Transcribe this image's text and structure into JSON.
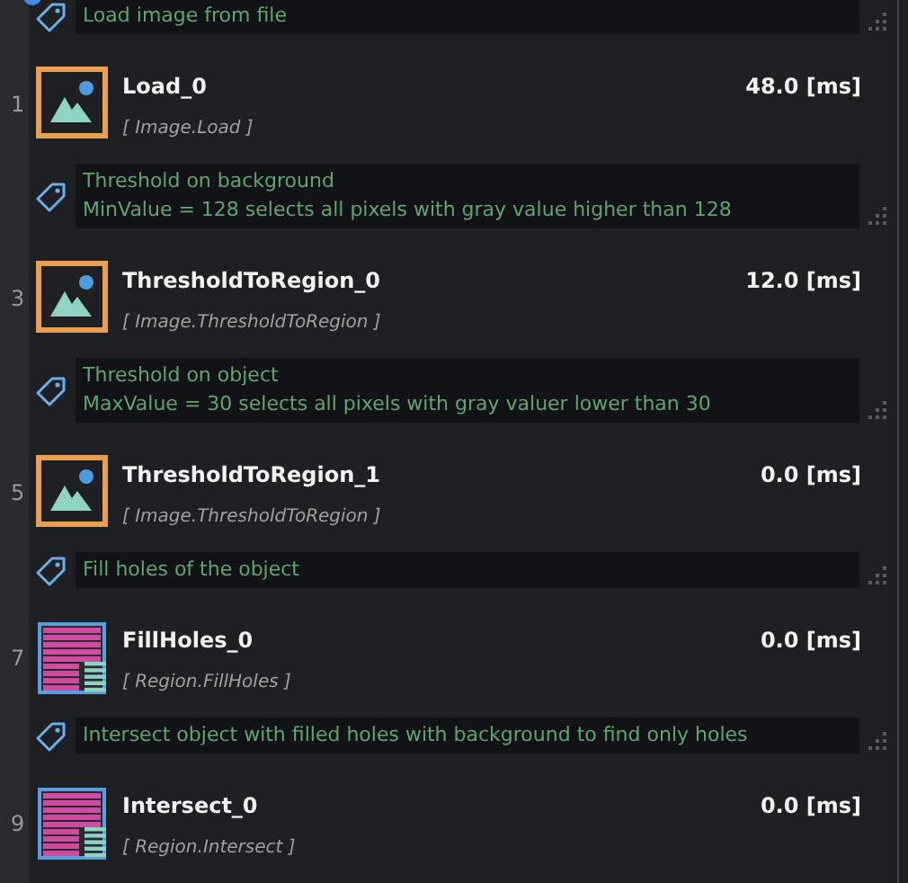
{
  "items": [
    {
      "kind": "comment",
      "lines": [
        "Load image from file"
      ]
    },
    {
      "kind": "image-step",
      "number": "1",
      "name": "Load_0",
      "type": "[ Image.Load ]",
      "time": "48.0 [ms]"
    },
    {
      "kind": "comment",
      "lines": [
        "Threshold on background",
        "MinValue = 128 selects all pixels with gray value higher than 128"
      ]
    },
    {
      "kind": "image-step",
      "number": "3",
      "name": "ThresholdToRegion_0",
      "type": "[ Image.ThresholdToRegion ]",
      "time": "12.0 [ms]"
    },
    {
      "kind": "comment",
      "lines": [
        "Threshold on object",
        "MaxValue = 30 selects all pixels with gray valuer lower than 30"
      ]
    },
    {
      "kind": "image-step",
      "number": "5",
      "name": "ThresholdToRegion_1",
      "type": "[ Image.ThresholdToRegion ]",
      "time": "0.0 [ms]"
    },
    {
      "kind": "comment",
      "lines": [
        "Fill holes of the object"
      ]
    },
    {
      "kind": "region-step",
      "number": "7",
      "name": "FillHoles_0",
      "type": "[ Region.FillHoles ]",
      "time": "0.0 [ms]"
    },
    {
      "kind": "comment",
      "lines": [
        "Intersect object with filled holes with background to find only holes"
      ]
    },
    {
      "kind": "region-step",
      "number": "9",
      "name": "Intersect_0",
      "type": "[ Region.Intersect ]",
      "time": "0.0 [ms]"
    }
  ]
}
